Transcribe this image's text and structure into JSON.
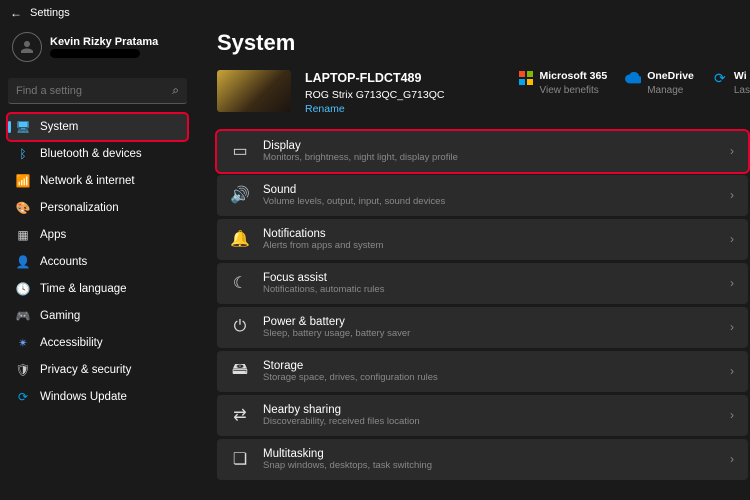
{
  "titlebar": {
    "label": "Settings"
  },
  "user": {
    "name": "Kevin Rizky Pratama"
  },
  "search": {
    "placeholder": "Find a setting"
  },
  "nav": [
    {
      "label": "System",
      "icon": "🖥",
      "color": "#4cc2ff",
      "active": true
    },
    {
      "label": "Bluetooth & devices",
      "icon": "ᛒ",
      "color": "#4cc2ff"
    },
    {
      "label": "Network & internet",
      "icon": "📶",
      "color": "#ccc"
    },
    {
      "label": "Personalization",
      "icon": "🎨",
      "color": "#ff6aa0"
    },
    {
      "label": "Apps",
      "icon": "▦",
      "color": "#ccc"
    },
    {
      "label": "Accounts",
      "icon": "👤",
      "color": "#ff9a5a"
    },
    {
      "label": "Time & language",
      "icon": "🕓",
      "color": "#ccc"
    },
    {
      "label": "Gaming",
      "icon": "🎮",
      "color": "#7abf5a"
    },
    {
      "label": "Accessibility",
      "icon": "✴",
      "color": "#6aa0ff"
    },
    {
      "label": "Privacy & security",
      "icon": "🛡",
      "color": "#ccc"
    },
    {
      "label": "Windows Update",
      "icon": "⟳",
      "color": "#00a4ef"
    }
  ],
  "page": {
    "title": "System"
  },
  "device": {
    "name": "LAPTOP-FLDCT489",
    "model": "ROG Strix G713QC_G713QC",
    "rename": "Rename"
  },
  "cloud": [
    {
      "title": "Microsoft 365",
      "sub": "View benefits",
      "icon": "ms365"
    },
    {
      "title": "OneDrive",
      "sub": "Manage",
      "icon": "onedrive"
    },
    {
      "title": "Wi",
      "sub": "Las",
      "icon": "update"
    }
  ],
  "settings": [
    {
      "title": "Display",
      "desc": "Monitors, brightness, night light, display profile",
      "icon": "display",
      "highlight": true
    },
    {
      "title": "Sound",
      "desc": "Volume levels, output, input, sound devices",
      "icon": "sound"
    },
    {
      "title": "Notifications",
      "desc": "Alerts from apps and system",
      "icon": "bell"
    },
    {
      "title": "Focus assist",
      "desc": "Notifications, automatic rules",
      "icon": "moon"
    },
    {
      "title": "Power & battery",
      "desc": "Sleep, battery usage, battery saver",
      "icon": "power"
    },
    {
      "title": "Storage",
      "desc": "Storage space, drives, configuration rules",
      "icon": "storage"
    },
    {
      "title": "Nearby sharing",
      "desc": "Discoverability, received files location",
      "icon": "share"
    },
    {
      "title": "Multitasking",
      "desc": "Snap windows, desktops, task switching",
      "icon": "multi"
    }
  ]
}
